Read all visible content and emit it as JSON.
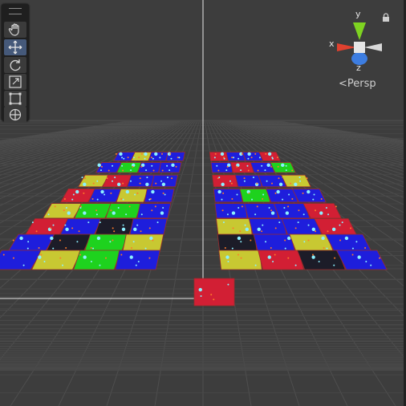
{
  "viewport": {
    "projection_label": "Persp",
    "colors": {
      "background": "#3d3d3d",
      "grid": "#4f4f4f",
      "red": "#d21f34",
      "green": "#1ed21e",
      "blue": "#1e1edc",
      "yellow": "#c8c832",
      "black": "#1c1c28"
    }
  },
  "gizmo": {
    "x_label": "x",
    "y_label": "y",
    "z_label": "z"
  },
  "toolbar": {
    "tools": [
      {
        "name": "hand-tool",
        "icon": "hand-icon"
      },
      {
        "name": "move-tool",
        "icon": "move-icon",
        "active": true
      },
      {
        "name": "rotate-tool",
        "icon": "rotate-icon"
      },
      {
        "name": "scale-tool",
        "icon": "scale-icon"
      },
      {
        "name": "rect-tool",
        "icon": "rect-icon"
      },
      {
        "name": "transform-tool",
        "icon": "transform-icon"
      }
    ]
  },
  "tiles": {
    "left_rows": [
      [
        "blue",
        "yellow",
        "blue",
        "blue"
      ],
      [
        "blue",
        "green",
        "blue",
        "blue"
      ],
      [
        "yellow",
        "red",
        "blue",
        "blue"
      ],
      [
        "red",
        "blue",
        "yellow",
        "blue"
      ],
      [
        "yellow",
        "green",
        "green",
        "blue"
      ],
      [
        "red",
        "blue",
        "black",
        "blue"
      ],
      [
        "blue",
        "black",
        "green",
        "yellow"
      ],
      [
        "blue",
        "yellow",
        "green",
        "blue"
      ]
    ],
    "right_rows": [
      [
        "red",
        "blue",
        "blue",
        "red"
      ],
      [
        "blue",
        "red",
        "blue",
        "green"
      ],
      [
        "red",
        "blue",
        "blue",
        "yellow"
      ],
      [
        "blue",
        "green",
        "blue",
        "blue"
      ],
      [
        "blue",
        "blue",
        "blue",
        "red"
      ],
      [
        "yellow",
        "blue",
        "blue",
        "red"
      ],
      [
        "black",
        "blue",
        "yellow",
        "blue"
      ],
      [
        "yellow",
        "red",
        "black",
        "blue"
      ]
    ],
    "selected_tile": "red"
  }
}
